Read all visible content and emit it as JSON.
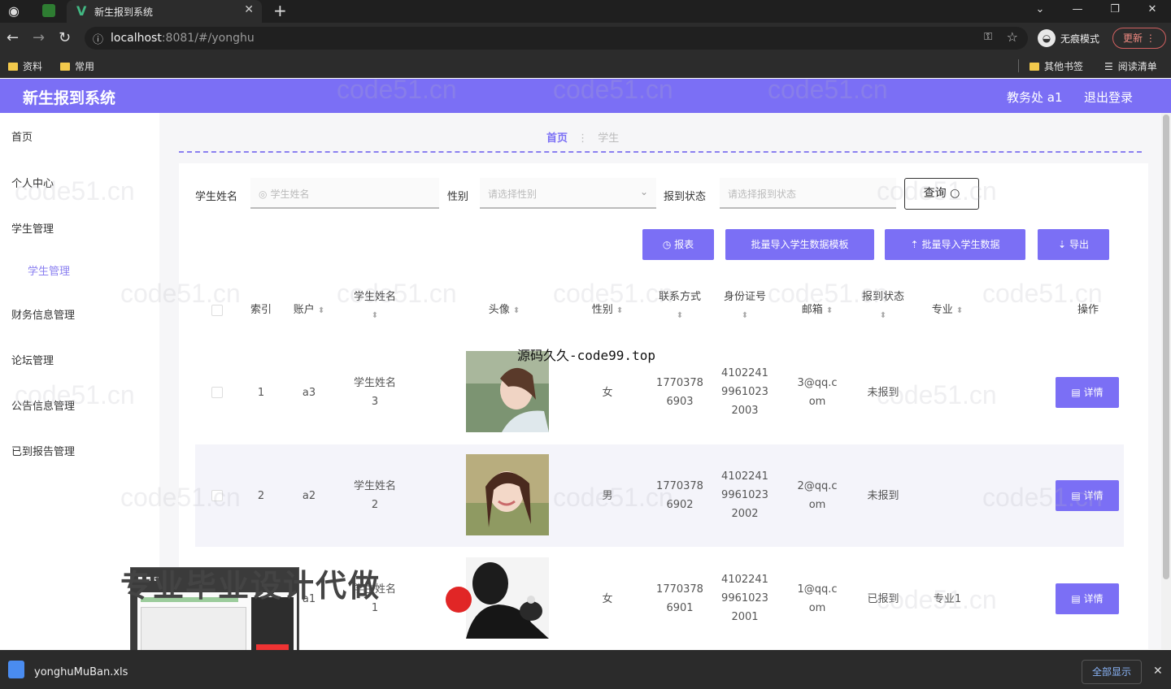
{
  "browser": {
    "tab_title": "新生报到系统",
    "url_host": "localhost",
    "url_rest": ":8081/#/yonghu",
    "profile_label": "无痕模式",
    "update_label": "更新",
    "bookmarks": [
      "资料",
      "常用"
    ],
    "bookmarks_right": [
      "其他书签",
      "阅读清单"
    ]
  },
  "header": {
    "title": "新生报到系统",
    "user": "教务处 a1",
    "logout": "退出登录"
  },
  "sidebar": {
    "items": [
      "首页",
      "个人中心",
      "学生管理",
      "财务信息管理",
      "论坛管理",
      "公告信息管理",
      "已到报告管理"
    ],
    "sub_item": "学生管理"
  },
  "breadcrumb": {
    "home": "首页",
    "current": "学生"
  },
  "filters": {
    "name_label": "学生姓名",
    "name_placeholder": "学生姓名",
    "gender_label": "性别",
    "gender_placeholder": "请选择性别",
    "status_label": "报到状态",
    "status_placeholder": "请选择报到状态",
    "query_label": "查询"
  },
  "actions": {
    "report": "报表",
    "template": "批量导入学生数据模板",
    "import": "批量导入学生数据",
    "export": "导出"
  },
  "table": {
    "headers": {
      "index": "索引",
      "account": "账户",
      "name": "学生姓名",
      "avatar": "头像",
      "gender": "性别",
      "phone": "联系方式",
      "idcard": "身份证号",
      "email": "邮箱",
      "status": "报到状态",
      "major": "专业",
      "ops": "操作"
    },
    "detail_label": "详情",
    "rows": [
      {
        "index": "1",
        "account": "a3",
        "name1": "学生姓名",
        "name2": "3",
        "gender": "女",
        "phone1": "1770378",
        "phone2": "6903",
        "id1": "4102241",
        "id2": "9961023",
        "id3": "2003",
        "email1": "3@qq.c",
        "email2": "om",
        "status": "未报到",
        "major": ""
      },
      {
        "index": "2",
        "account": "a2",
        "name1": "学生姓名",
        "name2": "2",
        "gender": "男",
        "phone1": "1770378",
        "phone2": "6902",
        "id1": "4102241",
        "id2": "9961023",
        "id3": "2002",
        "email1": "2@qq.c",
        "email2": "om",
        "status": "未报到",
        "major": ""
      },
      {
        "index": "3",
        "account": "a1",
        "name1": "学生姓名",
        "name2": "1",
        "gender": "女",
        "phone1": "1770378",
        "phone2": "6901",
        "id1": "4102241",
        "id2": "9961023",
        "id3": "2001",
        "email1": "1@qq.c",
        "email2": "om",
        "status": "已报到",
        "major": "专业1"
      }
    ]
  },
  "overlay": {
    "source_watermark": "源码久久-code99.top",
    "promo": "专业毕业设计代做",
    "watermark_text": "code51.cn"
  },
  "download": {
    "file": "yonghuMuBan.xls",
    "show_all": "全部显示"
  }
}
